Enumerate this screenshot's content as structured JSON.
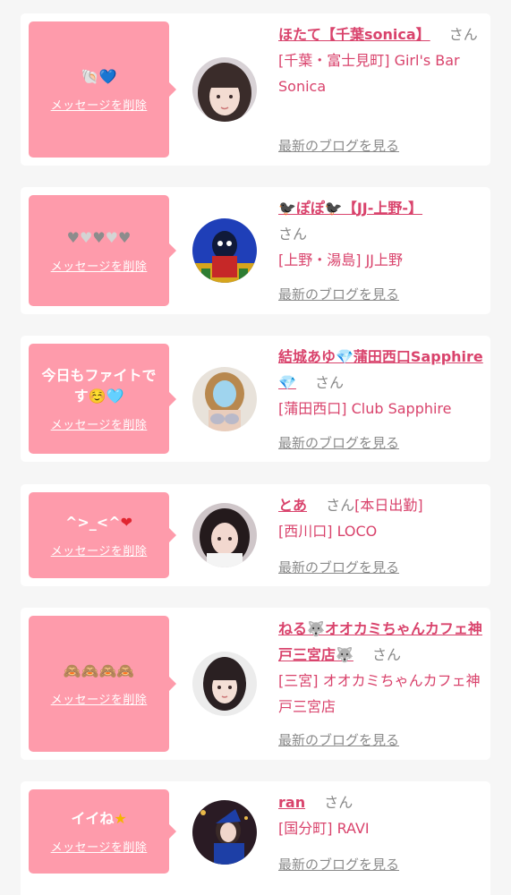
{
  "delete_label": "メッセージを削除",
  "blog_label": "最新のブログを見る",
  "honorific": "さん",
  "items": [
    {
      "message": "🐚💙",
      "name": "ほたて【千葉sonica】",
      "area_shop": "[千葉・富士見町] Girl's Bar Sonica",
      "status": ""
    },
    {
      "message": "🩶🤍🩶🤍🩶",
      "name": "🐦‍⬛ぽぽ🐦‍⬛【JJ-上野-】",
      "area_shop": "[上野・湯島] JJ上野",
      "status": ""
    },
    {
      "message": "今日もファイトです☺️🩵",
      "name": "結城あゆ💎蒲田西口Sapphire💎",
      "area_shop": "[蒲田西口] Club Sapphire",
      "status": ""
    },
    {
      "message": "^&gt;_&lt;^❤️",
      "name": "とあ",
      "area_shop": "[西川口] LOCO",
      "status": "[本日出勤]"
    },
    {
      "message": "🙈🙈🙈🙈",
      "name": "ねる🐺オオカミちゃんカフェ神戸三宮店🐺",
      "area_shop": "[三宮] オオカミちゃんカフェ神戸三宮店",
      "status": ""
    },
    {
      "message": "イイね🌟",
      "name": "ran",
      "area_shop": "[国分町] RAVI",
      "status": ""
    }
  ]
}
